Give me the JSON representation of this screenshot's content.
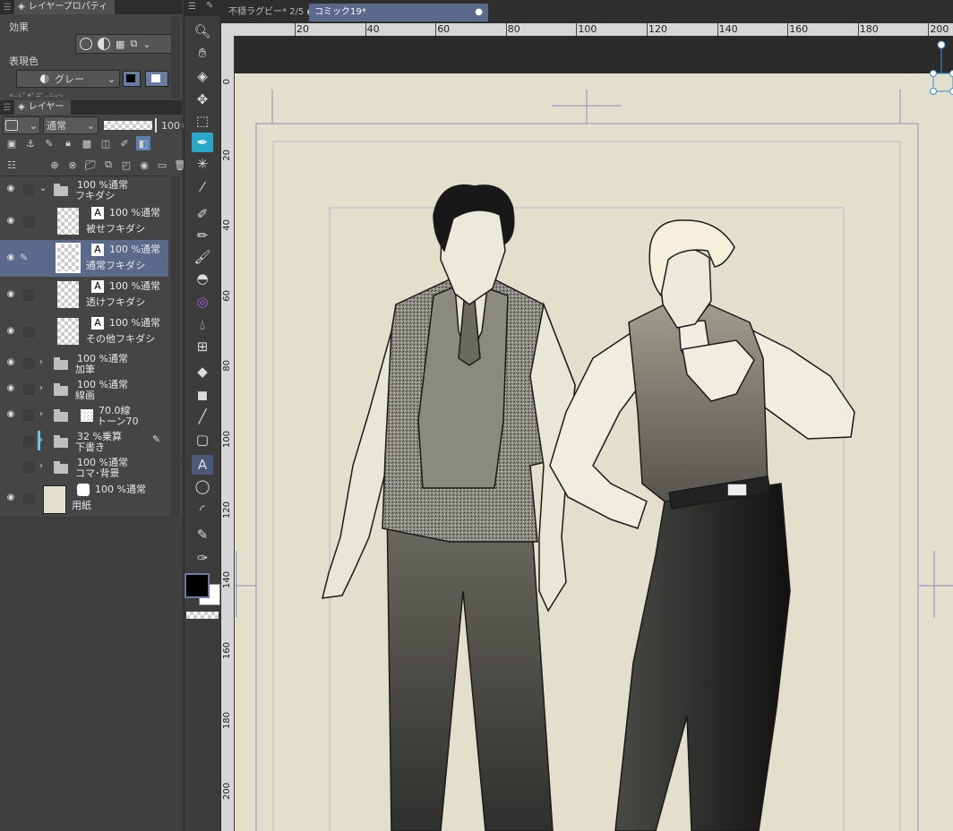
{
  "panels": {
    "layer_property_tab": "レイヤープロパティ",
    "effect_label": "効果",
    "expression_color_label": "表現色",
    "expression_color_value": "グレー",
    "cut_label": "ﾊｰﾄﾞｶﾞﾃﾞｰｼｮﾝ",
    "layer_tab": "レイヤー",
    "blend_mode": "通常",
    "opacity": "100"
  },
  "layers": [
    {
      "pct": "100 %通常",
      "name": "フキダシ",
      "type": "folder-open"
    },
    {
      "pct": "100 %通常",
      "name": "被せフキダシ",
      "type": "balloon"
    },
    {
      "pct": "100 %通常",
      "name": "通常フキダシ",
      "type": "balloon",
      "selected": true
    },
    {
      "pct": "100 %通常",
      "name": "透けフキダシ",
      "type": "balloon"
    },
    {
      "pct": "100 %通常",
      "name": "その他フキダシ",
      "type": "balloon"
    },
    {
      "pct": "100 %通常",
      "name": "加筆",
      "type": "folder"
    },
    {
      "pct": "100 %通常",
      "name": "線画",
      "type": "folder"
    },
    {
      "pct": "70.0線",
      "name": "トーン70",
      "type": "tone"
    },
    {
      "pct": "32 %乗算",
      "name": "下書き",
      "type": "folder"
    },
    {
      "pct": "100 %通常",
      "name": "コマ･背景",
      "type": "folder"
    },
    {
      "pct": "100 %通常",
      "name": "用紙",
      "type": "paper"
    }
  ],
  "tabs": [
    {
      "label": "不穏ラグビー*",
      "page": "2/5"
    },
    {
      "label": "コミック19*"
    }
  ],
  "ruler_h": [
    "20",
    "40",
    "60",
    "80",
    "100",
    "120",
    "140",
    "160",
    "180",
    "200"
  ],
  "ruler_v": [
    "0",
    "20",
    "40",
    "60",
    "80",
    "100",
    "120",
    "140",
    "160",
    "180",
    "200"
  ],
  "colors": {
    "main": "#000000",
    "sub": "#ffffff",
    "paper": "#e2dfcc",
    "accent": "#5b6a8a"
  }
}
